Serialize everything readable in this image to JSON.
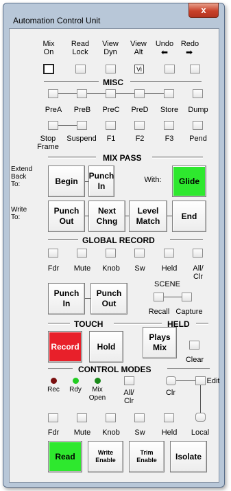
{
  "window": {
    "title": "Automation Control Unit",
    "close_label": "x"
  },
  "top": {
    "mix_on": "Mix\nOn",
    "read_lock": "Read\nLock",
    "view_dyn": "View\nDyn",
    "view_alt": "View\nAlt",
    "undo": "Undo",
    "redo": "Redo",
    "view_alt_icon": "Vi"
  },
  "misc": {
    "title": "MISC",
    "row1": [
      "PreA",
      "PreB",
      "PreC",
      "PreD",
      "Store",
      "Dump"
    ],
    "row2": [
      "Stop\nFrame",
      "Suspend",
      "F1",
      "F2",
      "F3",
      "Pend"
    ]
  },
  "mixpass": {
    "title": "MIX PASS",
    "extend_label": "Extend\nBack\nTo:",
    "write_label": "Write\nTo:",
    "with_label": "With:",
    "begin": "Begin",
    "punch_in": "Punch\nIn",
    "glide": "Glide",
    "punch_out": "Punch\nOut",
    "next_chng": "Next\nChng",
    "level_match": "Level\nMatch",
    "end": "End"
  },
  "global": {
    "title": "GLOBAL RECORD",
    "row": [
      "Fdr",
      "Mute",
      "Knob",
      "Sw",
      "Held",
      "All/\nClr"
    ],
    "punch_in": "Punch\nIn",
    "punch_out": "Punch\nOut",
    "scene": "SCENE",
    "recall": "Recall",
    "capture": "Capture"
  },
  "touch": {
    "title": "TOUCH",
    "held_title": "HELD",
    "record": "Record",
    "hold": "Hold",
    "plays_mix": "Plays\nMix",
    "clear": "Clear"
  },
  "modes": {
    "title": "CONTROL MODES",
    "rec": "Rec",
    "rdy": "Rdy",
    "mix_open": "Mix\nOpen",
    "all_clr": "All/\nClr",
    "clr": "Clr",
    "edit": "Edit",
    "row": [
      "Fdr",
      "Mute",
      "Knob",
      "Sw",
      "Held",
      "Local"
    ],
    "read": "Read",
    "write_enable": "Write\nEnable",
    "trim_enable": "Trim\nEnable",
    "isolate": "Isolate"
  },
  "colors": {
    "green": "#2ee82e",
    "red": "#e8202a",
    "rec_led": "#7a1010",
    "rdy_led": "#22cc22",
    "mix_led": "#1a8a1a"
  }
}
